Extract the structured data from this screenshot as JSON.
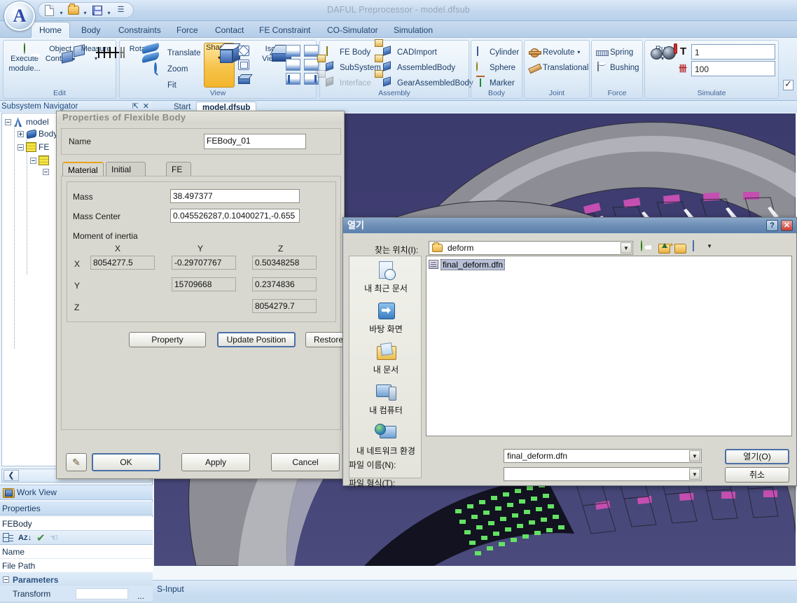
{
  "window": {
    "title": "DAFUL Preprocessor - model.dfsub",
    "orb_glyph": "A"
  },
  "quick_access": {
    "items": [
      {
        "name": "new-document",
        "icon": "new-document-icon"
      },
      {
        "name": "open-document",
        "icon": "open-folder-icon"
      },
      {
        "name": "save-document",
        "icon": "save-disk-icon"
      },
      {
        "name": "customize-quick-access",
        "icon": "overflow-chevron-icon"
      }
    ]
  },
  "ribbon": {
    "tabs": [
      {
        "label": "Home",
        "active": true
      },
      {
        "label": "Body",
        "active": false
      },
      {
        "label": "Constraints",
        "active": false
      },
      {
        "label": "Force",
        "active": false
      },
      {
        "label": "Contact",
        "active": false
      },
      {
        "label": "FE Constraint",
        "active": false
      },
      {
        "label": "CO-Simulator",
        "active": false
      },
      {
        "label": "Simulation",
        "active": false
      }
    ],
    "groups": {
      "edit": {
        "label": "Edit",
        "buttons": [
          {
            "line1": "Execute",
            "line2": "module...",
            "icon": "execute-module-icon"
          },
          {
            "line1": "Object",
            "line2": "Control",
            "icon": "object-control-icon",
            "dropdown": true
          },
          {
            "line1": "Measure",
            "line2": "",
            "icon": "measure-icon",
            "dropdown": true
          }
        ]
      },
      "view": {
        "label": "View",
        "rotate_label": "Rotate",
        "items": [
          {
            "label": "Translate",
            "icon": "translate-icon"
          },
          {
            "label": "Zoom",
            "icon": "zoom-icon"
          },
          {
            "label": "Fit",
            "icon": "fit-icon"
          }
        ],
        "shaded_label": "Shaded",
        "iso_line1": "Iso",
        "iso_line2": "View"
      },
      "assembly": {
        "label": "Assembly",
        "items": [
          {
            "label": "FE Body",
            "icon": "fe-body-icon",
            "disabled": false
          },
          {
            "label": "SubSystem",
            "icon": "subsystem-icon",
            "disabled": false
          },
          {
            "label": "Interface",
            "icon": "interface-icon",
            "disabled": true
          },
          {
            "label": "CADImport",
            "icon": "cad-import-icon",
            "disabled": false
          },
          {
            "label": "AssembledBody",
            "icon": "assembled-body-icon",
            "disabled": false
          },
          {
            "label": "GearAssembledBody",
            "icon": "gear-assembled-body-icon",
            "disabled": false
          }
        ]
      },
      "body": {
        "label": "Body",
        "items": [
          {
            "label": "Cylinder",
            "icon": "cylinder-icon"
          },
          {
            "label": "Sphere",
            "icon": "sphere-icon"
          },
          {
            "label": "Marker",
            "icon": "marker-icon"
          }
        ]
      },
      "joint": {
        "label": "Joint",
        "items": [
          {
            "label": "Revolute",
            "icon": "revolute-joint-icon",
            "dropdown": true
          },
          {
            "label": "Translational",
            "icon": "translational-joint-icon",
            "dropdown": false
          }
        ]
      },
      "force": {
        "label": "Force",
        "items": [
          {
            "label": "Spring",
            "icon": "spring-icon"
          },
          {
            "label": "Bushing",
            "icon": "bushing-icon"
          }
        ]
      },
      "simulate": {
        "label": "Simulate",
        "run_label": "Run",
        "end_time_glyph": "T",
        "end_time_value": "1",
        "steps_glyph": "steps-icon",
        "steps_value": "100",
        "checkbox_checked": true
      }
    }
  },
  "sidebar": {
    "navigator_title": "Subsystem Navigator",
    "tree": [
      {
        "label": "model",
        "icon": "model-icon",
        "expander": "minus",
        "depth": 0
      },
      {
        "label": "Body",
        "icon": "body-folder-icon",
        "expander": "plus",
        "depth": 1
      },
      {
        "label": "FE",
        "icon": "fe-mesh-icon",
        "expander": "minus",
        "depth": 1
      },
      {
        "label": "",
        "icon": "fe-mesh-icon",
        "expander": "minus",
        "depth": 2
      },
      {
        "label": "",
        "icon": "",
        "expander": "minus",
        "depth": 3
      }
    ],
    "collapse_button": "❮",
    "work_view_tab": "Work View",
    "properties_header": "Properties",
    "properties_object": "FEBody",
    "properties_toolbar": [
      {
        "name": "categorized-view-icon"
      },
      {
        "name": "alphabetical-sort-icon"
      },
      {
        "name": "apply-check-icon"
      },
      {
        "name": "pick-pointer-icon"
      }
    ],
    "property_rows": [
      {
        "label": "Name",
        "value": "",
        "type": "row"
      },
      {
        "label": "File Path",
        "value": "",
        "type": "row"
      },
      {
        "label": "Parameters",
        "value": "",
        "type": "group"
      },
      {
        "label": "Transform",
        "value": "",
        "type": "row-input"
      }
    ]
  },
  "document_tabs": [
    {
      "label": "Start",
      "active": false
    },
    {
      "label": "model.dfsub",
      "active": true
    }
  ],
  "statusbar": {
    "text": "S-Input"
  },
  "properties_dialog": {
    "title": "Properties of Flexible Body",
    "name_label": "Name",
    "name_value": "FEBody_01",
    "tabs": [
      {
        "label": "Material",
        "active": true
      },
      {
        "label": "Initial Velocity",
        "active": false
      },
      {
        "label": "FE Info",
        "active": false
      }
    ],
    "mass_label": "Mass",
    "mass_value": "38.497377",
    "mass_center_label": "Mass Center",
    "mass_center_value": "0.045526287,0.10400271,-0.655",
    "moment_label": "Moment of inertia",
    "axis_headers": [
      "X",
      "Y",
      "Z"
    ],
    "row_labels": [
      "X",
      "Y",
      "Z"
    ],
    "inertia": [
      [
        "8054277.5",
        "-0.29707767",
        "0.50348258"
      ],
      [
        "",
        "15709668",
        "0.2374836"
      ],
      [
        "",
        "",
        "8054279.7"
      ]
    ],
    "action_buttons": [
      {
        "label": "Property"
      },
      {
        "label": "Update Position"
      },
      {
        "label": "Restore Position"
      }
    ],
    "footer_buttons": [
      {
        "label": "OK"
      },
      {
        "label": "Apply"
      },
      {
        "label": "Cancel"
      }
    ],
    "pick_button_icon": "pick-tool-icon"
  },
  "open_dialog": {
    "title": "열기",
    "help_button": "?",
    "close_button": "✕",
    "look_in_label": "찾는 위치(I):",
    "look_in_value": "deform",
    "toolbar": [
      {
        "name": "back-icon"
      },
      {
        "name": "up-folder-icon"
      },
      {
        "name": "new-folder-icon"
      },
      {
        "name": "views-dropdown-icon"
      }
    ],
    "places": [
      {
        "label": "내 최근 문서",
        "icon": "recent-documents-icon"
      },
      {
        "label": "바탕 화면",
        "icon": "desktop-icon"
      },
      {
        "label": "내 문서",
        "icon": "my-documents-icon"
      },
      {
        "label": "내 컴퓨터",
        "icon": "my-computer-icon"
      },
      {
        "label": "내 네트워크 환경",
        "icon": "my-network-icon"
      }
    ],
    "files": [
      {
        "label": "final_deform.dfn",
        "icon": "dfn-file-icon",
        "selected": true
      }
    ],
    "file_name_label": "파일 이름(N):",
    "file_name_value": "final_deform.dfn",
    "file_type_label": "파일 형식(T):",
    "file_type_value": "",
    "open_button": "열기(O)",
    "cancel_button": "취소"
  },
  "colors": {
    "scene_bg": "#3e3d70",
    "tire_body": "#8f8f96",
    "tire_highlight": "#c9c9cf",
    "mesh_green": "#5ee65e",
    "mesh_magenta": "#c850b4",
    "accent_orange": "#e8a11b"
  }
}
